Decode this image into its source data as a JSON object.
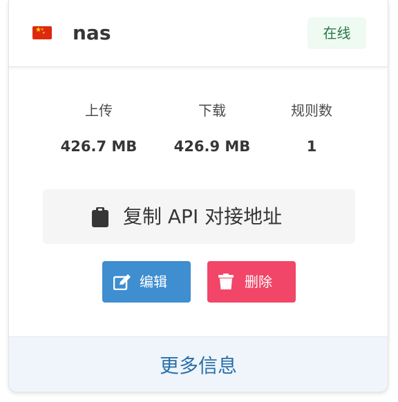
{
  "node": {
    "name": "nas",
    "status": "在线",
    "flag_icon": "china-flag-icon"
  },
  "stats": [
    {
      "label": "上传",
      "value": "426.7 MB"
    },
    {
      "label": "下载",
      "value": "426.9 MB"
    },
    {
      "label": "规则数",
      "value": "1"
    }
  ],
  "actions": {
    "copy_api": "复制 API 对接地址",
    "edit": "编辑",
    "delete": "删除",
    "more_info": "更多信息"
  },
  "colors": {
    "status_bg": "#effaf3",
    "status_text": "#257942",
    "edit": "#3e8ed0",
    "delete": "#f14668",
    "footer_bg": "#eff5fb",
    "footer_text": "#296fa8"
  }
}
